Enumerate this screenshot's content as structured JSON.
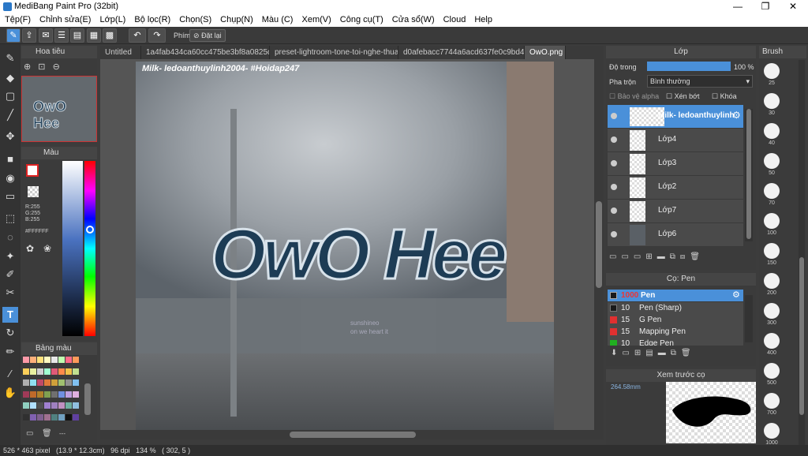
{
  "app": {
    "title": "MediBang Paint Pro (32bit)"
  },
  "window_controls": {
    "min": "—",
    "max": "❐",
    "close": "✕"
  },
  "menu": [
    "Tệp(F)",
    "Chỉnh sửa(E)",
    "Lớp(L)",
    "Bộ lọc(R)",
    "Chọn(S)",
    "Chụp(N)",
    "Màu (C)",
    "Xem(V)",
    "Công cụ(T)",
    "Cửa sổ(W)",
    "Cloud",
    "Help"
  ],
  "toolbar": {
    "label": "Phím",
    "reset": "Đặt lại"
  },
  "navigator": {
    "title": "Hoa tiêu"
  },
  "color_panel": {
    "title": "Màu",
    "r": "R:255",
    "g": "G:255",
    "b": "B:255",
    "hex": "#FFFFFF"
  },
  "palette": {
    "title": "Bảng màu",
    "footer": "---"
  },
  "tabs": [
    {
      "label": "Untitled",
      "active": false
    },
    {
      "label": "1a4fab434ca60cc475be3bf8a0825d99.jpg",
      "active": false
    },
    {
      "label": "preset-lightroom-tone-toi-nghe-thuat-5.jpg",
      "active": false
    },
    {
      "label": "d0afebacc7744a6acd637fe0c9bd41ea.jpg",
      "active": false
    },
    {
      "label": "OwO.png",
      "active": true
    }
  ],
  "canvas": {
    "watermark": "Milk- ledoanthuylinh2004- #Hoidap247",
    "art_text": "OwO Hee",
    "wall_text_1": "sunshineo",
    "wall_text_2": "on we heart it"
  },
  "layers_panel": {
    "title": "Lớp",
    "opacity_label": "Độ trong",
    "opacity_value": "100 %",
    "opacity_level": 100,
    "blend_label": "Pha trộn",
    "blend_value": "Bình thường",
    "protect_alpha": "Bảo vệ alpha",
    "clip": "Xén bớt",
    "lock": "Khóa",
    "layers": [
      {
        "name": "Milk- ledoanthuylinh",
        "selected": true
      },
      {
        "name": "Lớp4",
        "selected": false
      },
      {
        "name": "Lớp3",
        "selected": false
      },
      {
        "name": "Lớp2",
        "selected": false
      },
      {
        "name": "Lớp7",
        "selected": false
      },
      {
        "name": "Lớp6",
        "selected": false
      }
    ]
  },
  "brush_panel": {
    "title": "Cọ: Pen",
    "brushes": [
      {
        "size": "1000",
        "name": "Pen",
        "color": "#1a1a1a",
        "selected": true
      },
      {
        "size": "10",
        "name": "Pen (Sharp)",
        "color": "#1a1a1a",
        "selected": false
      },
      {
        "size": "15",
        "name": "G Pen",
        "color": "#e03030",
        "selected": false
      },
      {
        "size": "15",
        "name": "Mapping Pen",
        "color": "#e03030",
        "selected": false
      },
      {
        "size": "10",
        "name": "Edge Pen",
        "color": "#20b020",
        "selected": false
      }
    ]
  },
  "preview_panel": {
    "title": "Xem trước cọ",
    "size": "264.58mm"
  },
  "brush_size_panel": {
    "title": "Brush",
    "sizes": [
      "25",
      "30",
      "40",
      "50",
      "70",
      "100",
      "150",
      "200",
      "300",
      "400",
      "500",
      "700",
      "1000"
    ]
  },
  "status": {
    "text": "526 * 463 pixel   (13.9 * 12.3cm)   96 dpi   134 %   ( 302, 5 )"
  },
  "colors": {
    "accent": "#4a90d9",
    "selected_brush": "#4a90d9",
    "art_blue": "#1d3c55"
  }
}
